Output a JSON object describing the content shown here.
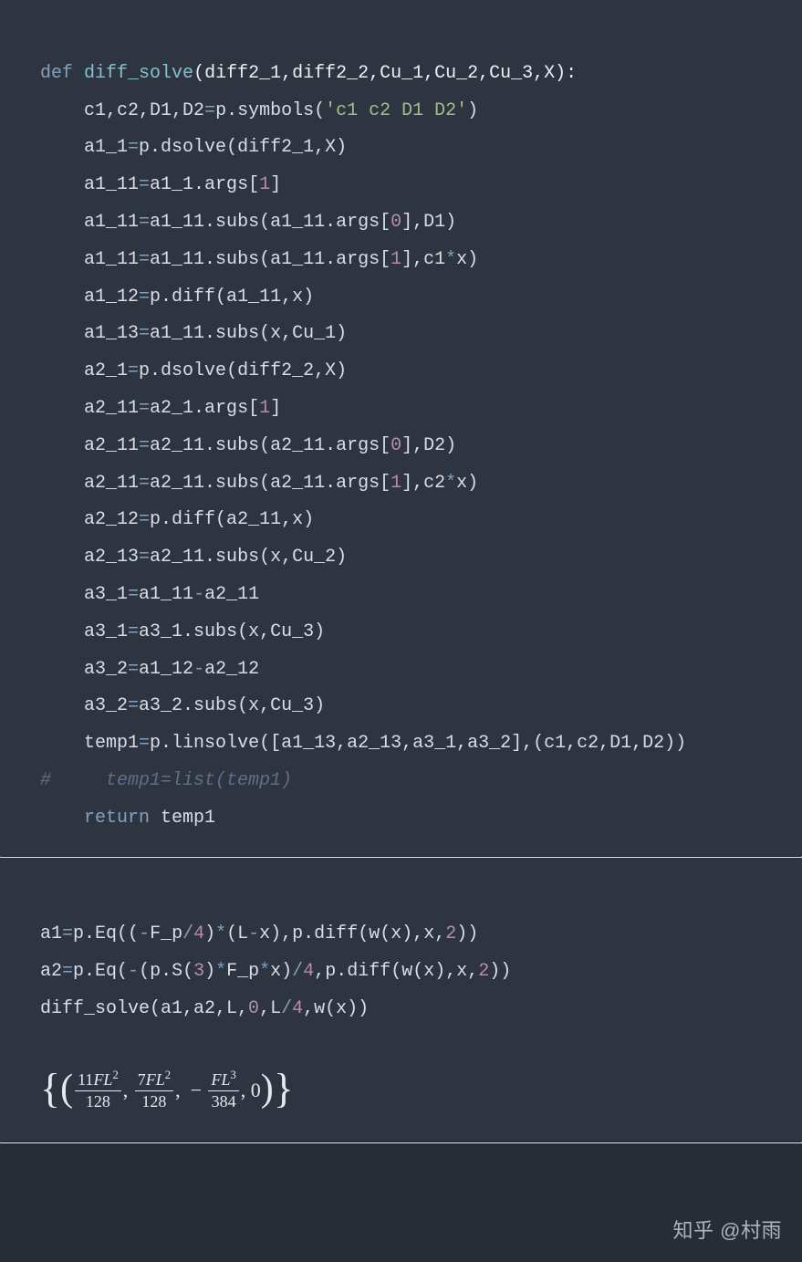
{
  "code1": {
    "l1": {
      "kw": "def",
      "fn": "diff_solve",
      "args": "(diff2_1,diff2_2,Cu_1,Cu_2,Cu_3,X):"
    },
    "l2": {
      "lhs": "c1,c2,D1,D2",
      "rhs_a": "p.symbols(",
      "str": "'c1 c2 D1 D2'",
      "rhs_b": ")"
    },
    "l3": {
      "lhs": "a1_1",
      "rhs": "p.dsolve(diff2_1,X)"
    },
    "l4": {
      "lhs": "a1_11",
      "rhs_a": "a1_1.args[",
      "n": "1",
      "rhs_b": "]"
    },
    "l5": {
      "lhs": "a1_11",
      "rhs_a": "a1_11.subs(a1_11.args[",
      "n": "0",
      "rhs_b": "],D1)"
    },
    "l6": {
      "lhs": "a1_11",
      "rhs_a": "a1_11.subs(a1_11.args[",
      "n": "1",
      "rhs_b": "],c1",
      "op": "*",
      "rhs_c": "x)"
    },
    "l7": {
      "lhs": "a1_12",
      "rhs": "p.diff(a1_11,x)"
    },
    "l8": {
      "lhs": "a1_13",
      "rhs": "a1_11.subs(x,Cu_1)"
    },
    "l9": {
      "lhs": "a2_1",
      "rhs": "p.dsolve(diff2_2,X)"
    },
    "l10": {
      "lhs": "a2_11",
      "rhs_a": "a2_1.args[",
      "n": "1",
      "rhs_b": "]"
    },
    "l11": {
      "lhs": "a2_11",
      "rhs_a": "a2_11.subs(a2_11.args[",
      "n": "0",
      "rhs_b": "],D2)"
    },
    "l12": {
      "lhs": "a2_11",
      "rhs_a": "a2_11.subs(a2_11.args[",
      "n": "1",
      "rhs_b": "],c2",
      "op": "*",
      "rhs_c": "x)"
    },
    "l13": {
      "lhs": "a2_12",
      "rhs": "p.diff(a2_11,x)"
    },
    "l14": {
      "lhs": "a2_13",
      "rhs": "a2_11.subs(x,Cu_2)"
    },
    "l15": {
      "lhs": "a3_1",
      "a": "a1_11",
      "b": "a2_11"
    },
    "l16": {
      "lhs": "a3_1",
      "rhs": "a3_1.subs(x,Cu_3)"
    },
    "l17": {
      "lhs": "a3_2",
      "a": "a1_12",
      "b": "a2_12"
    },
    "l18": {
      "lhs": "a3_2",
      "rhs": "a3_2.subs(x,Cu_3)"
    },
    "l19": {
      "lhs": "temp1",
      "rhs": "p.linsolve([a1_13,a2_13,a3_1,a3_2],(c1,c2,D1,D2))"
    },
    "l20": {
      "cmt": "#     temp1=list(temp1)"
    },
    "l21": {
      "kw": "return",
      "id": "temp1"
    }
  },
  "code2": {
    "l1": {
      "lhs": "a1",
      "a": "p.Eq((",
      "op1": "-",
      "b": "F_p",
      "op2": "/",
      "n1": "4",
      "c": ")",
      "op3": "*",
      "d": "(L",
      "op4": "-",
      "e": "x),p.diff(w(x),x,",
      "n2": "2",
      "f": "))"
    },
    "l2": {
      "lhs": "a2",
      "a": "p.Eq(",
      "op1": "-",
      "b": "(p.S(",
      "n1": "3",
      "c": ")",
      "op2": "*",
      "d": "F_p",
      "op3": "*",
      "e": "x)",
      "op4": "/",
      "n2": "4",
      "f": ",p.diff(w(x),x,",
      "n3": "2",
      "g": "))"
    },
    "l3": {
      "a": "diff_solve(a1,a2,L,",
      "n1": "0",
      "b": ",L",
      "op": "/",
      "n2": "4",
      "c": ",w(x))"
    }
  },
  "math": {
    "t1_num_a": "11",
    "t1_num_b": "FL",
    "t1_sup": "2",
    "t1_den": "128",
    "t2_num_a": "7",
    "t2_num_b": "FL",
    "t2_sup": "2",
    "t2_den": "128",
    "t3_num_b": "FL",
    "t3_sup": "3",
    "t3_den": "384",
    "t4": "0"
  },
  "watermark": "知乎 @村雨"
}
